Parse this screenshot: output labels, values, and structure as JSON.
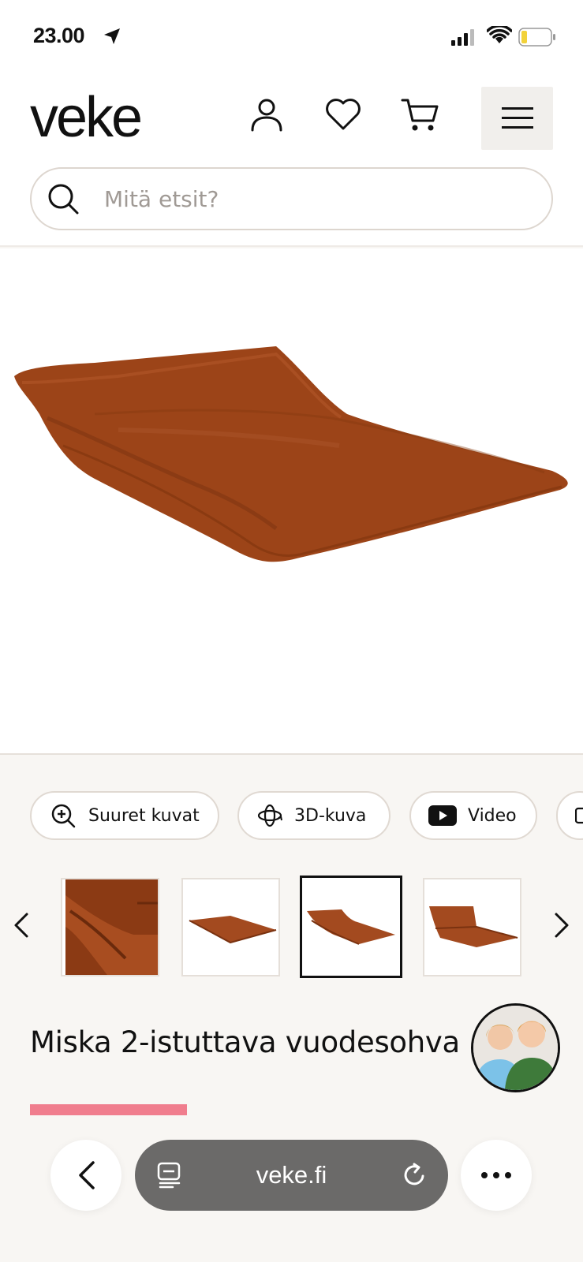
{
  "status_bar": {
    "time": "23.00"
  },
  "header": {
    "logo": "veke",
    "search_placeholder": "Mitä etsit?"
  },
  "product": {
    "color": "#a34a1f",
    "actions": [
      {
        "label": "Suuret kuvat",
        "icon": "zoom-in-icon"
      },
      {
        "label": "3D-kuva",
        "icon": "3d-rotate-icon"
      },
      {
        "label": "Video",
        "icon": "youtube-icon"
      }
    ],
    "title": "Miska 2-istuttava vuodesohva"
  },
  "browser": {
    "url": "veke.fi"
  },
  "colors": {
    "accent_pink": "#f07d8d",
    "chip_border": "#e0d9d2",
    "page_bg": "#f8f6f3"
  }
}
